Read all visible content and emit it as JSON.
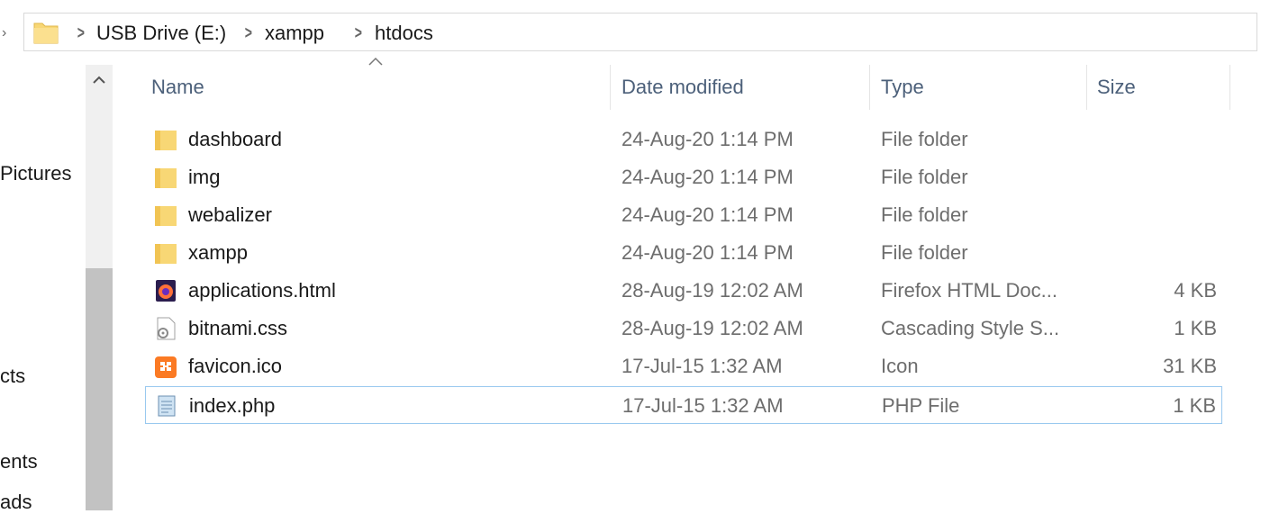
{
  "breadcrumb": [
    "USB Drive (E:)",
    "xampp",
    "htdocs"
  ],
  "sidebar": {
    "items": [
      "Pictures",
      "cts",
      "ents",
      "ads"
    ]
  },
  "columns": {
    "name": "Name",
    "date": "Date modified",
    "type": "Type",
    "size": "Size"
  },
  "files": [
    {
      "name": "dashboard",
      "date": "24-Aug-20 1:14 PM",
      "type": "File folder",
      "size": "",
      "icon": "folder-icon"
    },
    {
      "name": "img",
      "date": "24-Aug-20 1:14 PM",
      "type": "File folder",
      "size": "",
      "icon": "folder-icon"
    },
    {
      "name": "webalizer",
      "date": "24-Aug-20 1:14 PM",
      "type": "File folder",
      "size": "",
      "icon": "folder-icon"
    },
    {
      "name": "xampp",
      "date": "24-Aug-20 1:14 PM",
      "type": "File folder",
      "size": "",
      "icon": "folder-icon"
    },
    {
      "name": "applications.html",
      "date": "28-Aug-19 12:02 AM",
      "type": "Firefox HTML Doc...",
      "size": "4 KB",
      "icon": "firefox-icon"
    },
    {
      "name": "bitnami.css",
      "date": "28-Aug-19 12:02 AM",
      "type": "Cascading Style S...",
      "size": "1 KB",
      "icon": "css-file-icon"
    },
    {
      "name": "favicon.ico",
      "date": "17-Jul-15 1:32 AM",
      "type": "Icon",
      "size": "31 KB",
      "icon": "xampp-icon"
    },
    {
      "name": "index.php",
      "date": "17-Jul-15 1:32 AM",
      "type": "PHP File",
      "size": "1 KB",
      "icon": "php-file-icon"
    }
  ]
}
